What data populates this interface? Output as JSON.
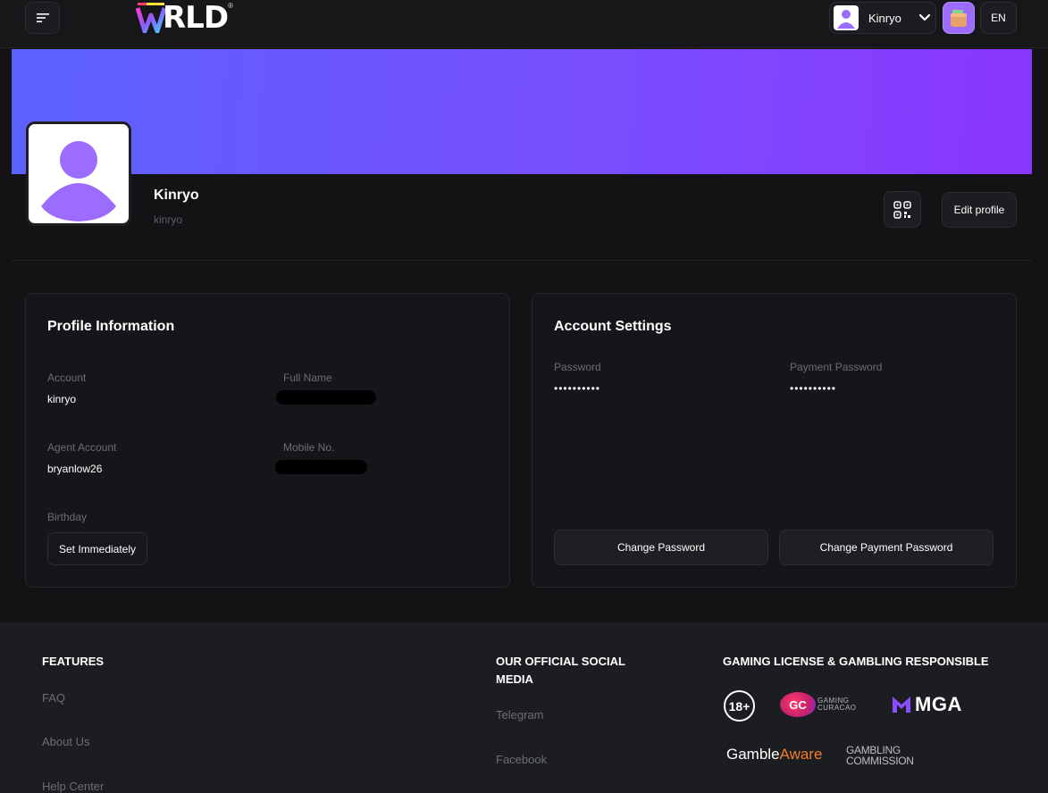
{
  "header": {
    "logo_text": "RLD",
    "logo_mark": "®",
    "user_name": "Kinryo",
    "language": "EN"
  },
  "profile": {
    "display_name": "Kinryo",
    "handle": "kinryo",
    "edit_label": "Edit profile"
  },
  "profile_info": {
    "title": "Profile Information",
    "account_label": "Account",
    "account_value": "kinryo",
    "full_name_label": "Full Name",
    "agent_label": "Agent Account",
    "agent_value": "bryanlow26",
    "mobile_label": "Mobile No.",
    "birthday_label": "Birthday",
    "birthday_button": "Set Immediately"
  },
  "account_settings": {
    "title": "Account Settings",
    "password_label": "Password",
    "password_value": "••••••••••",
    "payment_password_label": "Payment Password",
    "payment_password_value": "••••••••••",
    "change_password": "Change Password",
    "change_payment_password": "Change Payment Password"
  },
  "footer": {
    "features_title": "FEATURES",
    "features_links": [
      "FAQ",
      "About Us",
      "Help Center"
    ],
    "social_title": "OUR OFFICIAL SOCIAL MEDIA",
    "social_links": [
      "Telegram",
      "Facebook"
    ],
    "license_title": "GAMING LICENSE & GAMBLING RESPONSIBLE",
    "badge_18": "18+",
    "gc_initials": "GC",
    "gc_text": "GAMING CURACAO",
    "mga": "MGA",
    "gamble": "Gamble",
    "aware": "Aware",
    "gambling_commission_line1": "GAMBLING",
    "gambling_commission_line2": "COMMISSION"
  },
  "colors": {
    "background": "#131316",
    "banner_start": "#5b62ff",
    "banner_end": "#8b36fc",
    "avatar_purple": "#9b6cff",
    "aware_orange": "#f57a2c"
  }
}
